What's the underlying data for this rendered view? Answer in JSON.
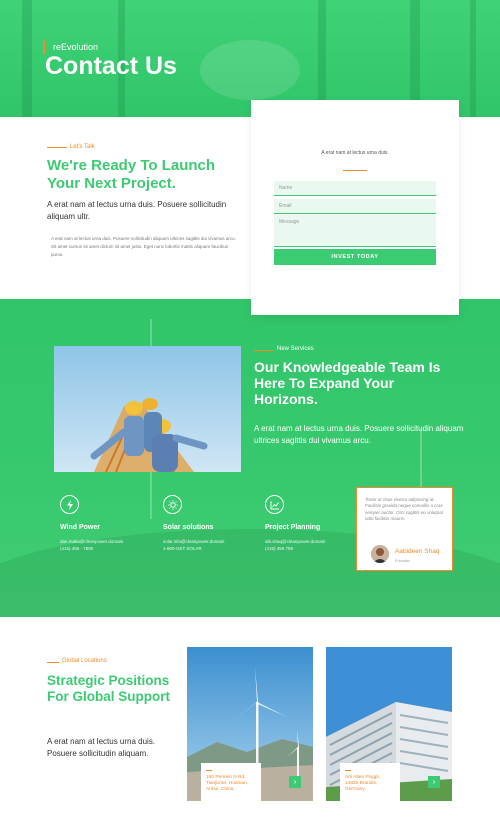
{
  "hero": {
    "kicker": "reEvolution",
    "title": "Contact Us"
  },
  "intro": {
    "kicker": "Let's Talk",
    "heading": "We're Ready To Launch Your Next Project.",
    "lead": "A erat nam at lectus urna duis. Posuere sollicitudin aliquam ultr.",
    "body": "A erat nam at lectus urna duis. Posuere sollicitudin aliquam ultrices sagittis dui vivamus arcu. Sit amet cursus sit amet dictum sit amet justo. Eget nunc lobortis mattis aliquam faucibus purus."
  },
  "form": {
    "tagline": "A erat nam at lectus urna duis.",
    "name_placeholder": "Name",
    "email_placeholder": "Email",
    "message_placeholder": "Message",
    "submit_label": "INVEST TODAY"
  },
  "services": {
    "kicker": "New Services",
    "heading": "Our Knowledgeable Team Is Here To Expand Your Horizons.",
    "lead": "A erat nam at lectus urna duis. Posuere sollicitudin aliquam ultrices sagittis dui vivamus arcu.",
    "features": [
      {
        "icon": "lightning-icon",
        "name": "Wind Power",
        "email": "dan.maka@cleanpower.domain",
        "phone": "(415) 456 - 7890"
      },
      {
        "icon": "sun-icon",
        "name": "Solar solutions",
        "email": "solar.info@cleanpower.domain",
        "phone": "1-800-GET SOLAR"
      },
      {
        "icon": "chart-icon",
        "name": "Project Planning",
        "email": "aib.shaq@cleanpower.domain",
        "phone": "(415) 456 789"
      }
    ]
  },
  "testimonial": {
    "quote": "Tortor at risus viverra adipiscing at. Facilisis gravida neque convallis a cras semper auctor. Orci sagittis eu volutpat odio facilisis mauris.",
    "name": "Aabideen Shaq",
    "role": "Founder"
  },
  "global": {
    "kicker": "Global Locations",
    "heading": "Strategic Positions For Global Support",
    "lead": "A erat nam at lectus urna duis. Posuere sollicitudin aliquam.",
    "locations": [
      {
        "address": "160 Renmin N Rd, Tianjia'an, Huainan, Anhui, China"
      },
      {
        "address": "Am Alten Flugpl., 14822 Brandis, Germany"
      }
    ],
    "arrow": "›"
  },
  "colors": {
    "green": "#3ccb72",
    "orange": "#f08a2c"
  }
}
